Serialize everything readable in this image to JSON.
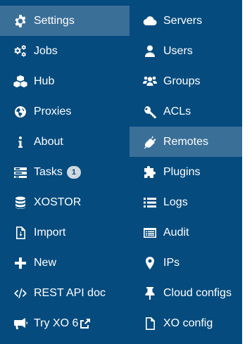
{
  "left_menu": [
    {
      "label": "Settings",
      "icon": "gear-icon",
      "active": true
    },
    {
      "label": "Jobs",
      "icon": "gears-icon"
    },
    {
      "label": "Hub",
      "icon": "cubes-icon"
    },
    {
      "label": "Proxies",
      "icon": "globe-icon"
    },
    {
      "label": "About",
      "icon": "info-icon"
    },
    {
      "label": "Tasks",
      "icon": "tasks-icon",
      "badge": "1"
    },
    {
      "label": "XOSTOR",
      "icon": "database-icon"
    },
    {
      "label": "Import",
      "icon": "file-import-icon"
    },
    {
      "label": "New",
      "icon": "plus-icon"
    },
    {
      "label": "REST API doc",
      "icon": "code-icon"
    },
    {
      "label": "Try XO 6",
      "icon": "bullhorn-icon",
      "external": true
    }
  ],
  "right_menu": [
    {
      "label": "Servers",
      "icon": "cloud-icon"
    },
    {
      "label": "Users",
      "icon": "user-icon"
    },
    {
      "label": "Groups",
      "icon": "users-icon"
    },
    {
      "label": "ACLs",
      "icon": "key-icon"
    },
    {
      "label": "Remotes",
      "icon": "plug-icon",
      "active": true
    },
    {
      "label": "Plugins",
      "icon": "puzzle-icon"
    },
    {
      "label": "Logs",
      "icon": "list-icon"
    },
    {
      "label": "Audit",
      "icon": "audit-list-icon"
    },
    {
      "label": "IPs",
      "icon": "map-marker-icon"
    },
    {
      "label": "Cloud configs",
      "icon": "thumbtack-icon"
    },
    {
      "label": "XO config",
      "icon": "file-icon"
    }
  ]
}
